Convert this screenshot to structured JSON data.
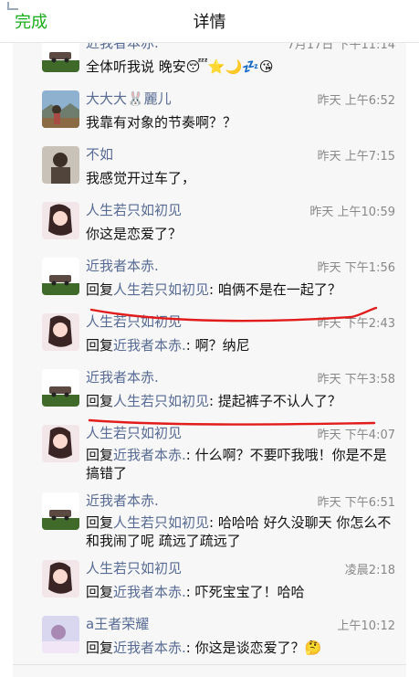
{
  "header": {
    "done_label": "完成",
    "title": "详情"
  },
  "messages": [
    {
      "name": "近我者本赤.",
      "time": "7月17日 下午11:14",
      "content": "全体听我说 晚安😴⭐🌙💤😘",
      "avatar": "car-avatar"
    },
    {
      "name": "大大大🐰麗儿",
      "time": "昨天 上午6:52",
      "content": "我靠有对象的节奏啊？？",
      "avatar": "landscape-avatar"
    },
    {
      "name": "不如",
      "time": "昨天 上午7:15",
      "content": "我感觉开过车了，",
      "avatar": "man-avatar"
    },
    {
      "name": "人生若只如初见",
      "time": "昨天 上午10:59",
      "content": "你这是恋爱了？",
      "avatar": "girl-avatar"
    },
    {
      "name": "近我者本赤.",
      "time": "昨天 下午1:56",
      "reply_prefix": "回复",
      "reply_to": "人生若只如初见",
      "content": ": 咱俩不是在一起了？",
      "avatar": "car-avatar"
    },
    {
      "name": "人生若只如初见",
      "time": "昨天 下午2:43",
      "reply_prefix": "回复",
      "reply_to": "近我者本赤.",
      "content": ": 啊？纳尼",
      "avatar": "girl-avatar"
    },
    {
      "name": "近我者本赤.",
      "time": "昨天 下午3:58",
      "reply_prefix": "回复",
      "reply_to": "人生若只如初见",
      "content": ": 提起裤子不认人了？",
      "avatar": "car-avatar"
    },
    {
      "name": "人生若只如初见",
      "time": "昨天 下午4:07",
      "reply_prefix": "回复",
      "reply_to": "近我者本赤.",
      "content": ": 什么啊？不要吓我哦！你是不是搞错了",
      "avatar": "girl-avatar"
    },
    {
      "name": "近我者本赤.",
      "time": "昨天 下午6:51",
      "reply_prefix": "回复",
      "reply_to": "人生若只如初见",
      "content": ": 哈哈哈 好久没聊天 你怎么不和我闹了呢 疏远了疏远了",
      "avatar": "car-avatar"
    },
    {
      "name": "人生若只如初见",
      "time": "凌晨2:18",
      "reply_prefix": "回复",
      "reply_to": "近我者本赤.",
      "content": ": 吓死宝宝了！哈哈",
      "avatar": "girl-avatar"
    },
    {
      "name": "a王者荣耀",
      "time": "上午10:12",
      "reply_prefix": "回复",
      "reply_to": "近我者本赤.",
      "content": ": 你这是谈恋爱了？🤔",
      "avatar": "pastel-avatar"
    }
  ],
  "colors": {
    "accent": "#1aad19",
    "name": "#576b95",
    "annotation": "#e21b1b"
  }
}
